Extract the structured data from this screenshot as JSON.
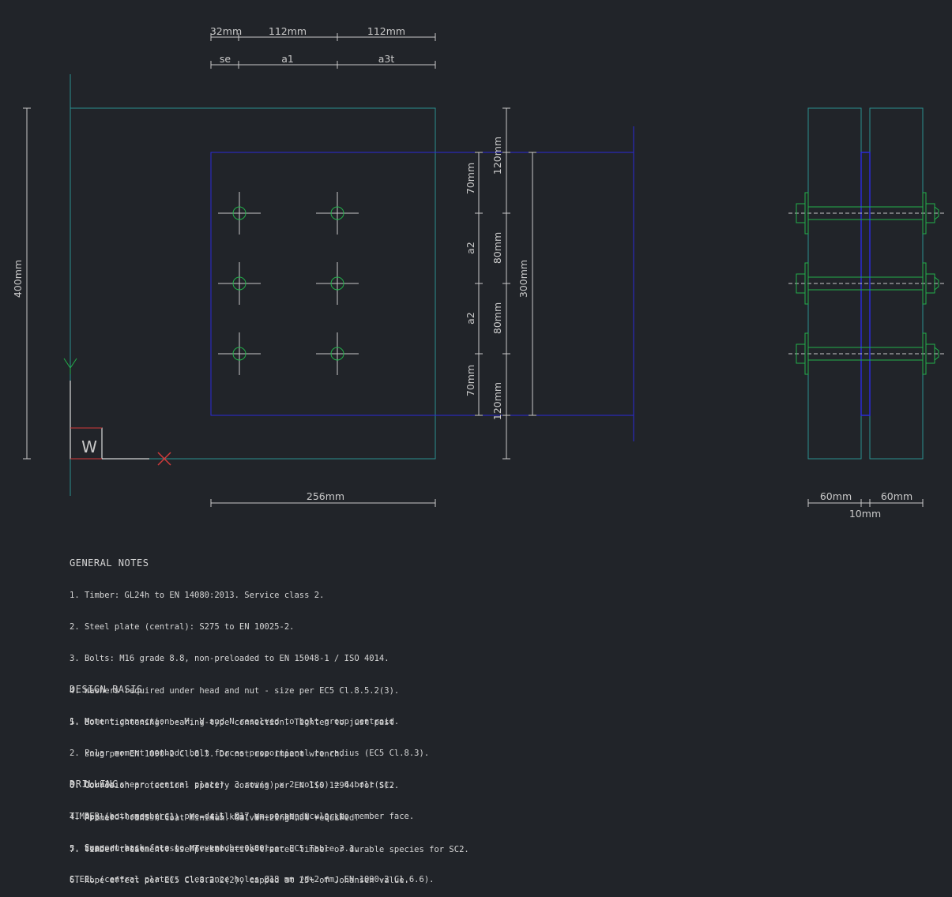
{
  "dims": {
    "top": [
      "32mm",
      "112mm",
      "112mm"
    ],
    "spacing": [
      "se",
      "a1",
      "a3t"
    ],
    "overall_height": "400mm",
    "plate_width": "256mm",
    "edge_top": "70mm",
    "a2_upper": "a2",
    "a2_lower": "a2",
    "edge_bottom": "70mm",
    "dist_top": "120mm",
    "row_spacing_1": "80mm",
    "row_spacing_2": "80mm",
    "dist_bottom": "120mm",
    "plate_height": "300mm",
    "member_left": "60mm",
    "member_right": "60mm",
    "plate_gap": "10mm"
  },
  "ucs_label": "W",
  "notes": {
    "general": {
      "title": "GENERAL NOTES",
      "lines": [
        "1. Timber: GL24h to EN 14080:2013. Service class 2.",
        "2. Steel plate (central): S275 to EN 10025-2.",
        "3. Bolts: M16 grade 8.8, non-preloaded to EN 15048-1 / ISO 4014.",
        "4. Washers required under head and nut - size per EC5 Cl.8.5.2(3).",
        "5. Bolt tightening: bearing-type connection. Tighten to just past",
        "   snug per EN 1090-2 Cl.8.3. Do not use impact wrench.",
        "6. Corrosion protection: specify coating per EN ISO 12944 for SC2.",
        "   Primer + finish coat minimum. Galvanizing not required.",
        "7. Timber treatment: use preservative-treated timber or durable species for SC2."
      ]
    },
    "design": {
      "title": "DESIGN BASIS",
      "lines": [
        "1. Moment connection - M, V and N resolved to bolt group centroid.",
        "2. Polar moment method: bolt forces proportional to radius (EC5 Cl.8.3).",
        "3. Double shear (central plate). 3 row(s) x 2 col(s) = 6 bolt(s).",
        "4. Applied loads (LC1): M = 4.5 kNm, V = 0 kN, N = 0 kN.",
        "5. Load-duration class: MT. kmod = 0.80 per EC5 Table 3.1.",
        "6. Rope effect per EC5 Cl.8.2.2(2), capped at 25% of Johansen value."
      ]
    },
    "drilling": {
      "title": "DRILLING",
      "lines": [
        "TIMBER (both members): pre-drill Ø17 mm perpendicular to member face.",
        "   Support back face to prevent breakout.",
        "STEEL (central plate): clearance holes Ø18 mm (d+2 mm, EN 1090-2 Cl.6.6)."
      ]
    }
  },
  "colors": {
    "background": "#212429",
    "timber": "#2a8f8f",
    "plate": "#2a2ad6",
    "bolt": "#22b04a",
    "dimension": "#c9c9c9",
    "axis_x": "#d23a3a"
  }
}
